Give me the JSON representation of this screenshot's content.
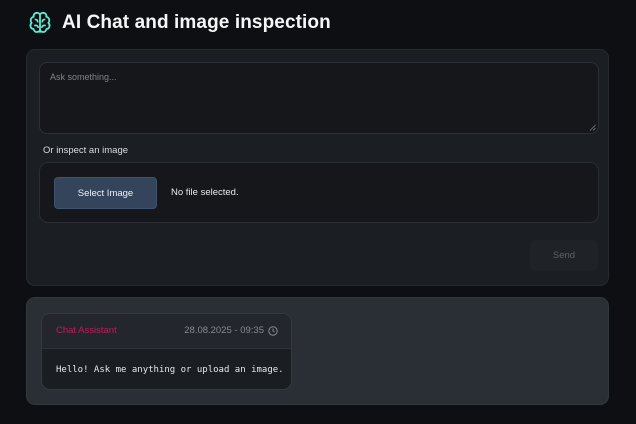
{
  "header": {
    "icon": "brain-icon",
    "title": "AI Chat and image inspection",
    "accent_color": "#5eead4"
  },
  "chat_input": {
    "placeholder": "Ask something...",
    "value": ""
  },
  "image_inspect": {
    "label": "Or inspect an image",
    "select_button_label": "Select Image",
    "file_status": "No file selected."
  },
  "send_button": {
    "label": "Send",
    "disabled": true
  },
  "messages": [
    {
      "sender": "Chat Assistant",
      "sender_color": "#c2185b",
      "timestamp": "28.08.2025 - 09:35",
      "icon": "clock-icon",
      "text": "Hello! Ask me anything or upload an image."
    }
  ]
}
